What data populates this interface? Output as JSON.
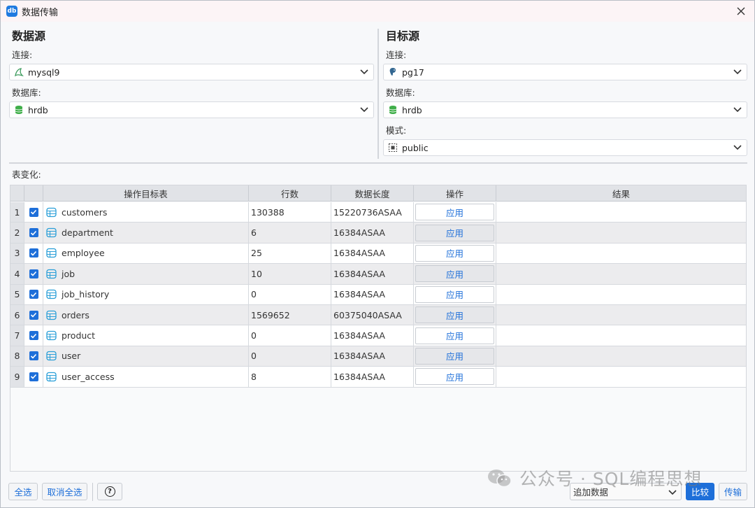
{
  "window": {
    "title": "数据传输",
    "app_icon_text": "db"
  },
  "source": {
    "heading": "数据源",
    "connection_label": "连接:",
    "connection_value": "mysql9",
    "database_label": "数据库:",
    "database_value": "hrdb"
  },
  "target": {
    "heading": "目标源",
    "connection_label": "连接:",
    "connection_value": "pg17",
    "database_label": "数据库:",
    "database_value": "hrdb",
    "schema_label": "模式:",
    "schema_value": "public"
  },
  "table_section_label": "表变化:",
  "columns": [
    "操作目标表",
    "行数",
    "数据长度",
    "操作",
    "结果"
  ],
  "rows": [
    {
      "num": "1",
      "name": "customers",
      "rows": "130388",
      "length": "15220736ASAA",
      "action": "应用",
      "result": ""
    },
    {
      "num": "2",
      "name": "department",
      "rows": "6",
      "length": "16384ASAA",
      "action": "应用",
      "result": ""
    },
    {
      "num": "3",
      "name": "employee",
      "rows": "25",
      "length": "16384ASAA",
      "action": "应用",
      "result": ""
    },
    {
      "num": "4",
      "name": "job",
      "rows": "10",
      "length": "16384ASAA",
      "action": "应用",
      "result": ""
    },
    {
      "num": "5",
      "name": "job_history",
      "rows": "0",
      "length": "16384ASAA",
      "action": "应用",
      "result": ""
    },
    {
      "num": "6",
      "name": "orders",
      "rows": "1569652",
      "length": "60375040ASAA",
      "action": "应用",
      "result": ""
    },
    {
      "num": "7",
      "name": "product",
      "rows": "0",
      "length": "16384ASAA",
      "action": "应用",
      "result": ""
    },
    {
      "num": "8",
      "name": "user",
      "rows": "0",
      "length": "16384ASAA",
      "action": "应用",
      "result": ""
    },
    {
      "num": "9",
      "name": "user_access",
      "rows": "8",
      "length": "16384ASAA",
      "action": "应用",
      "result": ""
    }
  ],
  "footer": {
    "select_all": "全选",
    "deselect_all": "取消全选",
    "help": "?",
    "mode_value": "追加数据",
    "compare": "比较",
    "transfer": "传输"
  },
  "watermark": "公众号 · SQL编程思想",
  "colors": {
    "accent": "#1e6fd9",
    "titlebar": "#fcf4f6",
    "db_icon": "#3fae49"
  }
}
